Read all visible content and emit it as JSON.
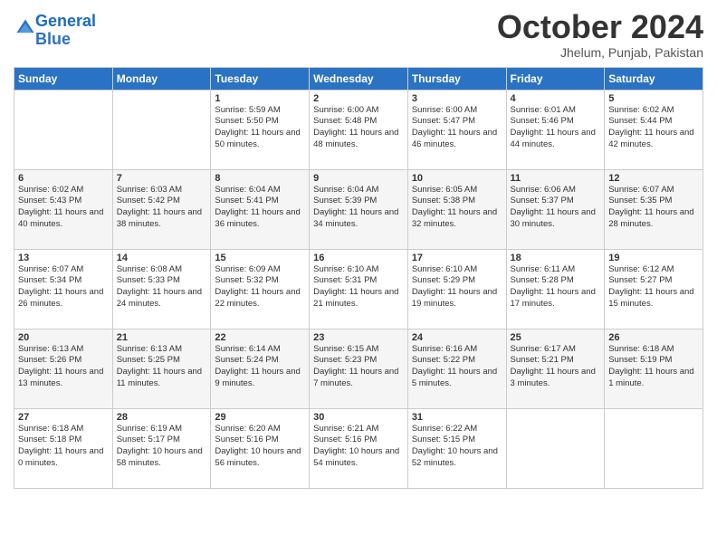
{
  "logo": {
    "line1": "General",
    "line2": "Blue"
  },
  "header": {
    "month": "October 2024",
    "location": "Jhelum, Punjab, Pakistan"
  },
  "weekdays": [
    "Sunday",
    "Monday",
    "Tuesday",
    "Wednesday",
    "Thursday",
    "Friday",
    "Saturday"
  ],
  "weeks": [
    [
      {
        "day": "",
        "text": ""
      },
      {
        "day": "",
        "text": ""
      },
      {
        "day": "1",
        "text": "Sunrise: 5:59 AM\nSunset: 5:50 PM\nDaylight: 11 hours and 50 minutes."
      },
      {
        "day": "2",
        "text": "Sunrise: 6:00 AM\nSunset: 5:48 PM\nDaylight: 11 hours and 48 minutes."
      },
      {
        "day": "3",
        "text": "Sunrise: 6:00 AM\nSunset: 5:47 PM\nDaylight: 11 hours and 46 minutes."
      },
      {
        "day": "4",
        "text": "Sunrise: 6:01 AM\nSunset: 5:46 PM\nDaylight: 11 hours and 44 minutes."
      },
      {
        "day": "5",
        "text": "Sunrise: 6:02 AM\nSunset: 5:44 PM\nDaylight: 11 hours and 42 minutes."
      }
    ],
    [
      {
        "day": "6",
        "text": "Sunrise: 6:02 AM\nSunset: 5:43 PM\nDaylight: 11 hours and 40 minutes."
      },
      {
        "day": "7",
        "text": "Sunrise: 6:03 AM\nSunset: 5:42 PM\nDaylight: 11 hours and 38 minutes."
      },
      {
        "day": "8",
        "text": "Sunrise: 6:04 AM\nSunset: 5:41 PM\nDaylight: 11 hours and 36 minutes."
      },
      {
        "day": "9",
        "text": "Sunrise: 6:04 AM\nSunset: 5:39 PM\nDaylight: 11 hours and 34 minutes."
      },
      {
        "day": "10",
        "text": "Sunrise: 6:05 AM\nSunset: 5:38 PM\nDaylight: 11 hours and 32 minutes."
      },
      {
        "day": "11",
        "text": "Sunrise: 6:06 AM\nSunset: 5:37 PM\nDaylight: 11 hours and 30 minutes."
      },
      {
        "day": "12",
        "text": "Sunrise: 6:07 AM\nSunset: 5:35 PM\nDaylight: 11 hours and 28 minutes."
      }
    ],
    [
      {
        "day": "13",
        "text": "Sunrise: 6:07 AM\nSunset: 5:34 PM\nDaylight: 11 hours and 26 minutes."
      },
      {
        "day": "14",
        "text": "Sunrise: 6:08 AM\nSunset: 5:33 PM\nDaylight: 11 hours and 24 minutes."
      },
      {
        "day": "15",
        "text": "Sunrise: 6:09 AM\nSunset: 5:32 PM\nDaylight: 11 hours and 22 minutes."
      },
      {
        "day": "16",
        "text": "Sunrise: 6:10 AM\nSunset: 5:31 PM\nDaylight: 11 hours and 21 minutes."
      },
      {
        "day": "17",
        "text": "Sunrise: 6:10 AM\nSunset: 5:29 PM\nDaylight: 11 hours and 19 minutes."
      },
      {
        "day": "18",
        "text": "Sunrise: 6:11 AM\nSunset: 5:28 PM\nDaylight: 11 hours and 17 minutes."
      },
      {
        "day": "19",
        "text": "Sunrise: 6:12 AM\nSunset: 5:27 PM\nDaylight: 11 hours and 15 minutes."
      }
    ],
    [
      {
        "day": "20",
        "text": "Sunrise: 6:13 AM\nSunset: 5:26 PM\nDaylight: 11 hours and 13 minutes."
      },
      {
        "day": "21",
        "text": "Sunrise: 6:13 AM\nSunset: 5:25 PM\nDaylight: 11 hours and 11 minutes."
      },
      {
        "day": "22",
        "text": "Sunrise: 6:14 AM\nSunset: 5:24 PM\nDaylight: 11 hours and 9 minutes."
      },
      {
        "day": "23",
        "text": "Sunrise: 6:15 AM\nSunset: 5:23 PM\nDaylight: 11 hours and 7 minutes."
      },
      {
        "day": "24",
        "text": "Sunrise: 6:16 AM\nSunset: 5:22 PM\nDaylight: 11 hours and 5 minutes."
      },
      {
        "day": "25",
        "text": "Sunrise: 6:17 AM\nSunset: 5:21 PM\nDaylight: 11 hours and 3 minutes."
      },
      {
        "day": "26",
        "text": "Sunrise: 6:18 AM\nSunset: 5:19 PM\nDaylight: 11 hours and 1 minute."
      }
    ],
    [
      {
        "day": "27",
        "text": "Sunrise: 6:18 AM\nSunset: 5:18 PM\nDaylight: 11 hours and 0 minutes."
      },
      {
        "day": "28",
        "text": "Sunrise: 6:19 AM\nSunset: 5:17 PM\nDaylight: 10 hours and 58 minutes."
      },
      {
        "day": "29",
        "text": "Sunrise: 6:20 AM\nSunset: 5:16 PM\nDaylight: 10 hours and 56 minutes."
      },
      {
        "day": "30",
        "text": "Sunrise: 6:21 AM\nSunset: 5:16 PM\nDaylight: 10 hours and 54 minutes."
      },
      {
        "day": "31",
        "text": "Sunrise: 6:22 AM\nSunset: 5:15 PM\nDaylight: 10 hours and 52 minutes."
      },
      {
        "day": "",
        "text": ""
      },
      {
        "day": "",
        "text": ""
      }
    ]
  ]
}
